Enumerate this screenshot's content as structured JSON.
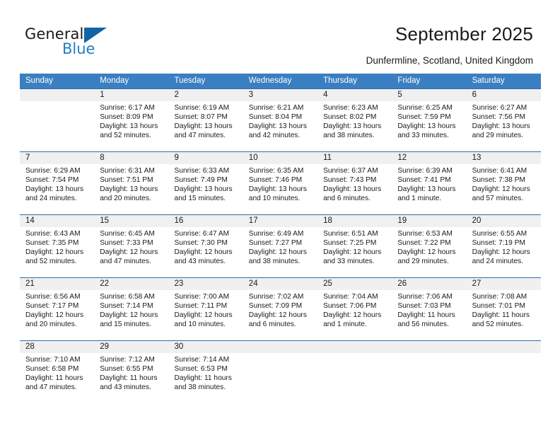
{
  "brand": {
    "name_top": "General",
    "name_bottom": "Blue",
    "accent_color": "#1f7ec2",
    "triangle_color": "#1364a5"
  },
  "header": {
    "title": "September 2025",
    "subtitle": "Dunfermline, Scotland, United Kingdom"
  },
  "theme": {
    "header_bg": "#3a7fc1",
    "header_text": "#ffffff",
    "daynum_bg": "#f0f0f0",
    "row_divider": "#2f6fad"
  },
  "weekdays": [
    "Sunday",
    "Monday",
    "Tuesday",
    "Wednesday",
    "Thursday",
    "Friday",
    "Saturday"
  ],
  "labels": {
    "sunrise_prefix": "Sunrise:",
    "sunset_prefix": "Sunset:",
    "daylight_prefix": "Daylight:"
  },
  "weeks": [
    [
      {
        "day": "",
        "sunrise": "",
        "sunset": "",
        "daylight_line1": "",
        "daylight_line2": ""
      },
      {
        "day": "1",
        "sunrise": "Sunrise: 6:17 AM",
        "sunset": "Sunset: 8:09 PM",
        "daylight_line1": "Daylight: 13 hours",
        "daylight_line2": "and 52 minutes."
      },
      {
        "day": "2",
        "sunrise": "Sunrise: 6:19 AM",
        "sunset": "Sunset: 8:07 PM",
        "daylight_line1": "Daylight: 13 hours",
        "daylight_line2": "and 47 minutes."
      },
      {
        "day": "3",
        "sunrise": "Sunrise: 6:21 AM",
        "sunset": "Sunset: 8:04 PM",
        "daylight_line1": "Daylight: 13 hours",
        "daylight_line2": "and 42 minutes."
      },
      {
        "day": "4",
        "sunrise": "Sunrise: 6:23 AM",
        "sunset": "Sunset: 8:02 PM",
        "daylight_line1": "Daylight: 13 hours",
        "daylight_line2": "and 38 minutes."
      },
      {
        "day": "5",
        "sunrise": "Sunrise: 6:25 AM",
        "sunset": "Sunset: 7:59 PM",
        "daylight_line1": "Daylight: 13 hours",
        "daylight_line2": "and 33 minutes."
      },
      {
        "day": "6",
        "sunrise": "Sunrise: 6:27 AM",
        "sunset": "Sunset: 7:56 PM",
        "daylight_line1": "Daylight: 13 hours",
        "daylight_line2": "and 29 minutes."
      }
    ],
    [
      {
        "day": "7",
        "sunrise": "Sunrise: 6:29 AM",
        "sunset": "Sunset: 7:54 PM",
        "daylight_line1": "Daylight: 13 hours",
        "daylight_line2": "and 24 minutes."
      },
      {
        "day": "8",
        "sunrise": "Sunrise: 6:31 AM",
        "sunset": "Sunset: 7:51 PM",
        "daylight_line1": "Daylight: 13 hours",
        "daylight_line2": "and 20 minutes."
      },
      {
        "day": "9",
        "sunrise": "Sunrise: 6:33 AM",
        "sunset": "Sunset: 7:49 PM",
        "daylight_line1": "Daylight: 13 hours",
        "daylight_line2": "and 15 minutes."
      },
      {
        "day": "10",
        "sunrise": "Sunrise: 6:35 AM",
        "sunset": "Sunset: 7:46 PM",
        "daylight_line1": "Daylight: 13 hours",
        "daylight_line2": "and 10 minutes."
      },
      {
        "day": "11",
        "sunrise": "Sunrise: 6:37 AM",
        "sunset": "Sunset: 7:43 PM",
        "daylight_line1": "Daylight: 13 hours",
        "daylight_line2": "and 6 minutes."
      },
      {
        "day": "12",
        "sunrise": "Sunrise: 6:39 AM",
        "sunset": "Sunset: 7:41 PM",
        "daylight_line1": "Daylight: 13 hours",
        "daylight_line2": "and 1 minute."
      },
      {
        "day": "13",
        "sunrise": "Sunrise: 6:41 AM",
        "sunset": "Sunset: 7:38 PM",
        "daylight_line1": "Daylight: 12 hours",
        "daylight_line2": "and 57 minutes."
      }
    ],
    [
      {
        "day": "14",
        "sunrise": "Sunrise: 6:43 AM",
        "sunset": "Sunset: 7:35 PM",
        "daylight_line1": "Daylight: 12 hours",
        "daylight_line2": "and 52 minutes."
      },
      {
        "day": "15",
        "sunrise": "Sunrise: 6:45 AM",
        "sunset": "Sunset: 7:33 PM",
        "daylight_line1": "Daylight: 12 hours",
        "daylight_line2": "and 47 minutes."
      },
      {
        "day": "16",
        "sunrise": "Sunrise: 6:47 AM",
        "sunset": "Sunset: 7:30 PM",
        "daylight_line1": "Daylight: 12 hours",
        "daylight_line2": "and 43 minutes."
      },
      {
        "day": "17",
        "sunrise": "Sunrise: 6:49 AM",
        "sunset": "Sunset: 7:27 PM",
        "daylight_line1": "Daylight: 12 hours",
        "daylight_line2": "and 38 minutes."
      },
      {
        "day": "18",
        "sunrise": "Sunrise: 6:51 AM",
        "sunset": "Sunset: 7:25 PM",
        "daylight_line1": "Daylight: 12 hours",
        "daylight_line2": "and 33 minutes."
      },
      {
        "day": "19",
        "sunrise": "Sunrise: 6:53 AM",
        "sunset": "Sunset: 7:22 PM",
        "daylight_line1": "Daylight: 12 hours",
        "daylight_line2": "and 29 minutes."
      },
      {
        "day": "20",
        "sunrise": "Sunrise: 6:55 AM",
        "sunset": "Sunset: 7:19 PM",
        "daylight_line1": "Daylight: 12 hours",
        "daylight_line2": "and 24 minutes."
      }
    ],
    [
      {
        "day": "21",
        "sunrise": "Sunrise: 6:56 AM",
        "sunset": "Sunset: 7:17 PM",
        "daylight_line1": "Daylight: 12 hours",
        "daylight_line2": "and 20 minutes."
      },
      {
        "day": "22",
        "sunrise": "Sunrise: 6:58 AM",
        "sunset": "Sunset: 7:14 PM",
        "daylight_line1": "Daylight: 12 hours",
        "daylight_line2": "and 15 minutes."
      },
      {
        "day": "23",
        "sunrise": "Sunrise: 7:00 AM",
        "sunset": "Sunset: 7:11 PM",
        "daylight_line1": "Daylight: 12 hours",
        "daylight_line2": "and 10 minutes."
      },
      {
        "day": "24",
        "sunrise": "Sunrise: 7:02 AM",
        "sunset": "Sunset: 7:09 PM",
        "daylight_line1": "Daylight: 12 hours",
        "daylight_line2": "and 6 minutes."
      },
      {
        "day": "25",
        "sunrise": "Sunrise: 7:04 AM",
        "sunset": "Sunset: 7:06 PM",
        "daylight_line1": "Daylight: 12 hours",
        "daylight_line2": "and 1 minute."
      },
      {
        "day": "26",
        "sunrise": "Sunrise: 7:06 AM",
        "sunset": "Sunset: 7:03 PM",
        "daylight_line1": "Daylight: 11 hours",
        "daylight_line2": "and 56 minutes."
      },
      {
        "day": "27",
        "sunrise": "Sunrise: 7:08 AM",
        "sunset": "Sunset: 7:01 PM",
        "daylight_line1": "Daylight: 11 hours",
        "daylight_line2": "and 52 minutes."
      }
    ],
    [
      {
        "day": "28",
        "sunrise": "Sunrise: 7:10 AM",
        "sunset": "Sunset: 6:58 PM",
        "daylight_line1": "Daylight: 11 hours",
        "daylight_line2": "and 47 minutes."
      },
      {
        "day": "29",
        "sunrise": "Sunrise: 7:12 AM",
        "sunset": "Sunset: 6:55 PM",
        "daylight_line1": "Daylight: 11 hours",
        "daylight_line2": "and 43 minutes."
      },
      {
        "day": "30",
        "sunrise": "Sunrise: 7:14 AM",
        "sunset": "Sunset: 6:53 PM",
        "daylight_line1": "Daylight: 11 hours",
        "daylight_line2": "and 38 minutes."
      },
      {
        "day": "",
        "sunrise": "",
        "sunset": "",
        "daylight_line1": "",
        "daylight_line2": ""
      },
      {
        "day": "",
        "sunrise": "",
        "sunset": "",
        "daylight_line1": "",
        "daylight_line2": ""
      },
      {
        "day": "",
        "sunrise": "",
        "sunset": "",
        "daylight_line1": "",
        "daylight_line2": ""
      },
      {
        "day": "",
        "sunrise": "",
        "sunset": "",
        "daylight_line1": "",
        "daylight_line2": ""
      }
    ]
  ]
}
